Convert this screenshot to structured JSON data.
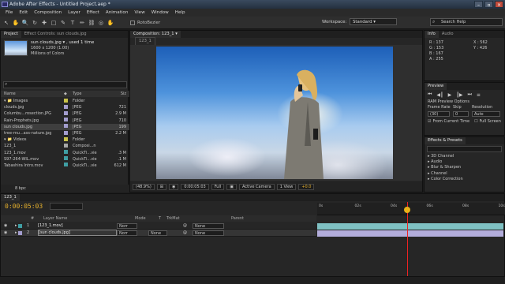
{
  "window": {
    "title": "Adobe After Effects - Untitled Project.aep *"
  },
  "menu": [
    "File",
    "Edit",
    "Composition",
    "Layer",
    "Effect",
    "Animation",
    "View",
    "Window",
    "Help"
  ],
  "toolbar": {
    "tools": [
      "↖",
      "✋",
      "🔍",
      "↻",
      "✚",
      "□",
      "✎",
      "T",
      "✏",
      "⛓",
      "◎",
      "✋"
    ],
    "roto_label": "RotoBezier",
    "workspace_label": "Workspace:",
    "workspace_value": "Standard",
    "search_placeholder": "Search Help"
  },
  "project": {
    "tabs": [
      "Project",
      "Effect Controls: sun clouds.jpg"
    ],
    "selected_name": "sun clouds.jpg ▾ , used 1 time",
    "selected_dims": "1600 x 1200 (1.00)",
    "selected_colors": "Millions of Colors",
    "headers": [
      "Name",
      "",
      "Type",
      "Siz"
    ],
    "rows": [
      {
        "name": "▾ 📁 Images",
        "label": "#c9c24a",
        "type": "Folder",
        "size": "",
        "sel": false
      },
      {
        "name": "    clouds.jpg",
        "label": "#a39dce",
        "type": "JPEG",
        "size": "721",
        "sel": false
      },
      {
        "name": "    Columbu...rosection.JPG",
        "label": "#a39dce",
        "type": "JPEG",
        "size": "2.9 M",
        "sel": false
      },
      {
        "name": "    Rain-Prophets.jpg",
        "label": "#a39dce",
        "type": "JPEG",
        "size": "710",
        "sel": false
      },
      {
        "name": "    sun clouds.jpg",
        "label": "#a39dce",
        "type": "JPEG",
        "size": "199",
        "sel": true
      },
      {
        "name": "    tree-mu...ass-nature.jpg",
        "label": "#a39dce",
        "type": "JPEG",
        "size": "2.2 M",
        "sel": false
      },
      {
        "name": "▾ 📁 Videos",
        "label": "#c9c24a",
        "type": "Folder",
        "size": "",
        "sel": false
      },
      {
        "name": "    123_1",
        "label": "#a8a8a8",
        "type": "Composi...n",
        "size": "",
        "sel": false
      },
      {
        "name": "    123_1.mov",
        "label": "#3f9ea3",
        "type": "QuickTi...vie",
        "size": ".3 M",
        "sel": false
      },
      {
        "name": "    S97-264-WIL.mov",
        "label": "#3f9ea3",
        "type": "QuickTi...vie",
        "size": ".1 M",
        "sel": false
      },
      {
        "name": "    Tabashira Intro.mov",
        "label": "#3f9ea3",
        "type": "QuickTi...vie",
        "size": "612 M",
        "sel": false
      }
    ],
    "footer_bpc": "8 bpc"
  },
  "composition": {
    "tab": "Composition: 123_1 ▾",
    "breadcrumb": "123_1",
    "zoom": "(48.9%)",
    "timecode": "0:00:05:03",
    "resolution": "Full",
    "camera": "Active Camera",
    "views": "1 View",
    "exposure": "+0.0"
  },
  "info": {
    "tabs": [
      "Info",
      "Audio"
    ],
    "r": "R : 137",
    "g": "G : 153",
    "b": "B : 167",
    "a": "A : 255",
    "x": "X : 562",
    "y": "Y : 426"
  },
  "preview": {
    "tab": "Preview",
    "ram_options": "RAM Preview Options",
    "frame_rate_label": "Frame Rate",
    "skip_label": "Skip",
    "resolution_label": "Resolution",
    "frame_rate_value": "(30)",
    "skip_value": "0",
    "resolution_value": "Auto",
    "from_current": "From Current Time",
    "full_screen": "Full Screen",
    "controls": [
      "⏮",
      "◀┃",
      "▶",
      "┃▶",
      "⏭",
      "≡"
    ]
  },
  "effects": {
    "tab": "Effects & Presets",
    "items": [
      "▸ 3D Channel",
      "▸ Audio",
      "▸ Blur & Sharpen",
      "▸ Channel",
      "▸ Color Correction"
    ]
  },
  "timeline": {
    "tab": "123_1",
    "timecode": "0:00:05:03",
    "headers": [
      "#",
      "Layer Name",
      "Mode",
      "T",
      "TrkMat",
      "Parent"
    ],
    "ruler": [
      "0s",
      "02s",
      "04s",
      "06s",
      "08s",
      "10s"
    ],
    "layers": [
      {
        "num": "1",
        "name": "[123_1.mov]",
        "mode": "Norr",
        "trkmat": "",
        "parent": "None",
        "color": "#3f9ea3",
        "sel": false
      },
      {
        "num": "2",
        "name": "[sun clouds.jpg]",
        "mode": "Norr",
        "trkmat": "None",
        "parent": "None",
        "color": "#a39dce",
        "sel": true
      }
    ]
  },
  "colors": {
    "accent": "#e7b12c",
    "playhead": "#e22222",
    "layer1": "#7fc1c3",
    "layer2": "#b3addb"
  }
}
